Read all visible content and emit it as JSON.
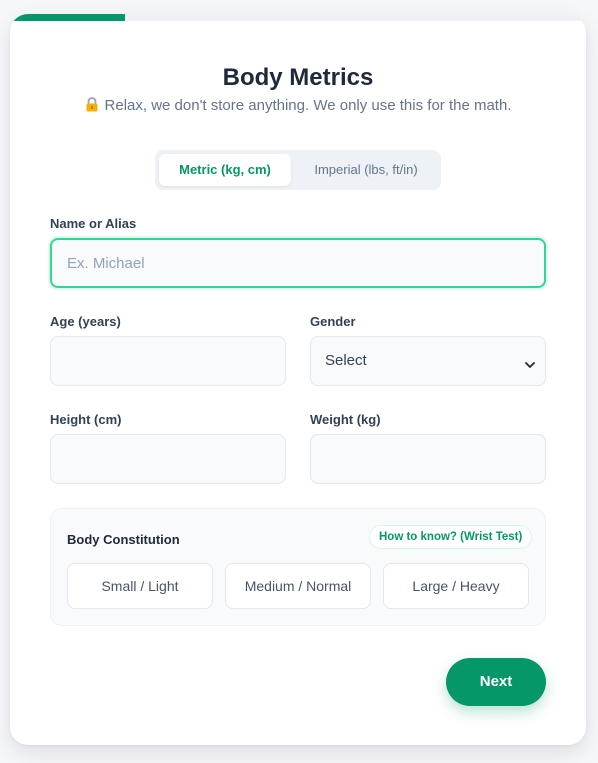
{
  "progress": {
    "fraction": 0.2
  },
  "header": {
    "title": "Body Metrics",
    "subtitle": "Relax, we don't store anything. We only use this for the math.",
    "subtitle_icon": "lock-icon"
  },
  "units": {
    "metric_label": "Metric (kg, cm)",
    "imperial_label": "Imperial (lbs, ft/in)",
    "selected": "metric"
  },
  "form": {
    "name": {
      "label": "Name or Alias",
      "placeholder": "Ex. Michael",
      "value": ""
    },
    "age": {
      "label": "Age (years)",
      "value": ""
    },
    "gender": {
      "label": "Gender",
      "selected": "Select"
    },
    "height": {
      "label": "Height (cm)",
      "value": ""
    },
    "weight": {
      "label": "Weight (kg)",
      "value": ""
    }
  },
  "constitution": {
    "title": "Body Constitution",
    "help_link": "How to know? (Wrist Test)",
    "options": [
      "Small / Light",
      "Medium / Normal",
      "Large / Heavy"
    ]
  },
  "actions": {
    "next_label": "Next"
  },
  "colors": {
    "accent": "#059669",
    "focus_border": "#34d399",
    "title": "#1e293b",
    "muted": "#64748b"
  }
}
